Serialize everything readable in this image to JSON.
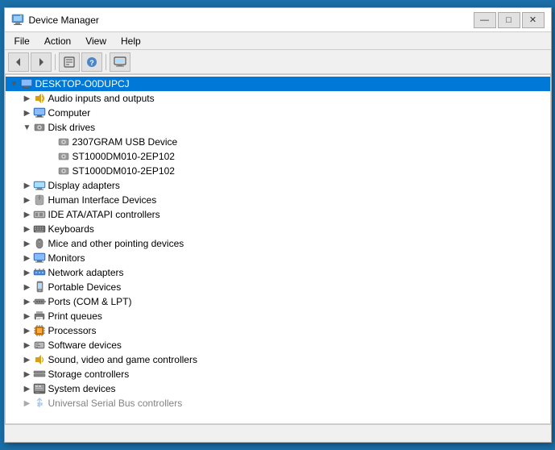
{
  "window": {
    "title": "Device Manager",
    "controls": {
      "minimize": "—",
      "maximize": "□",
      "close": "✕"
    }
  },
  "menu": {
    "items": [
      "File",
      "Action",
      "View",
      "Help"
    ]
  },
  "toolbar": {
    "buttons": [
      {
        "name": "back",
        "icon": "◀"
      },
      {
        "name": "forward",
        "icon": "▶"
      },
      {
        "name": "properties",
        "icon": "📋"
      },
      {
        "name": "help",
        "icon": "?"
      },
      {
        "name": "display",
        "icon": "🖥"
      }
    ]
  },
  "tree": {
    "root": {
      "label": "DESKTOP-O0DUPCJ",
      "expanded": true
    },
    "items": [
      {
        "level": 1,
        "label": "Audio inputs and outputs",
        "icon": "audio",
        "expanded": false
      },
      {
        "level": 1,
        "label": "Computer",
        "icon": "computer",
        "expanded": false
      },
      {
        "level": 1,
        "label": "Disk drives",
        "icon": "disk",
        "expanded": true
      },
      {
        "level": 2,
        "label": "2307GRAM USB Device",
        "icon": "disk_item"
      },
      {
        "level": 2,
        "label": "ST1000DM010-2EP102",
        "icon": "disk_item"
      },
      {
        "level": 2,
        "label": "ST1000DM010-2EP102",
        "icon": "disk_item"
      },
      {
        "level": 1,
        "label": "Display adapters",
        "icon": "display",
        "expanded": false
      },
      {
        "level": 1,
        "label": "Human Interface Devices",
        "icon": "hid",
        "expanded": false
      },
      {
        "level": 1,
        "label": "IDE ATA/ATAPI controllers",
        "icon": "ide",
        "expanded": false
      },
      {
        "level": 1,
        "label": "Keyboards",
        "icon": "keyboard",
        "expanded": false
      },
      {
        "level": 1,
        "label": "Mice and other pointing devices",
        "icon": "mouse",
        "expanded": false
      },
      {
        "level": 1,
        "label": "Monitors",
        "icon": "monitor",
        "expanded": false
      },
      {
        "level": 1,
        "label": "Network adapters",
        "icon": "network",
        "expanded": false
      },
      {
        "level": 1,
        "label": "Portable Devices",
        "icon": "portable",
        "expanded": false
      },
      {
        "level": 1,
        "label": "Ports (COM & LPT)",
        "icon": "ports",
        "expanded": false
      },
      {
        "level": 1,
        "label": "Print queues",
        "icon": "print",
        "expanded": false
      },
      {
        "level": 1,
        "label": "Processors",
        "icon": "proc",
        "expanded": false
      },
      {
        "level": 1,
        "label": "Software devices",
        "icon": "software",
        "expanded": false
      },
      {
        "level": 1,
        "label": "Sound, video and game controllers",
        "icon": "sound",
        "expanded": false
      },
      {
        "level": 1,
        "label": "Storage controllers",
        "icon": "storage",
        "expanded": false
      },
      {
        "level": 1,
        "label": "System devices",
        "icon": "system",
        "expanded": false
      },
      {
        "level": 1,
        "label": "Universal Serial Bus controllers",
        "icon": "usb",
        "expanded": false
      }
    ]
  },
  "status": ""
}
